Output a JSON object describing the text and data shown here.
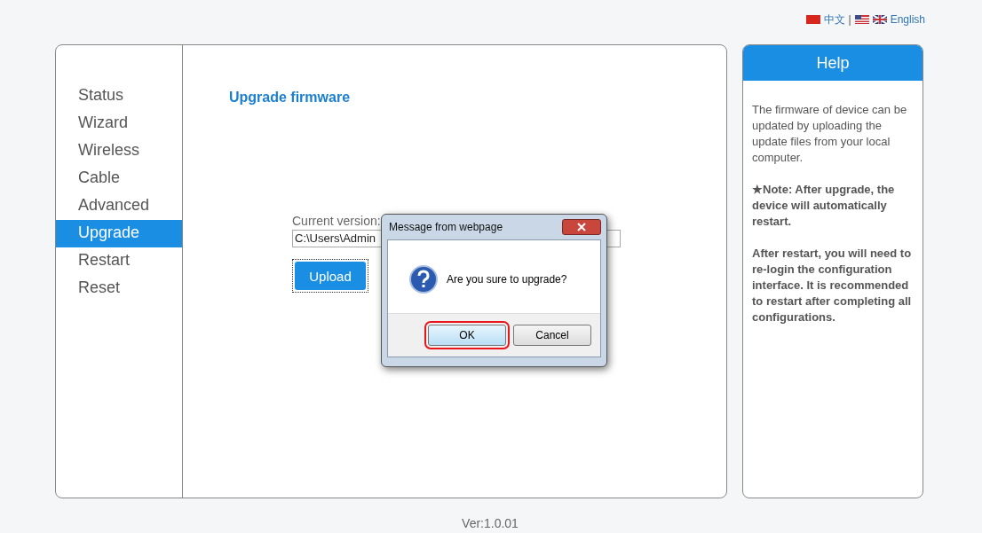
{
  "languages": [
    {
      "label": "中文"
    },
    {
      "label": "English"
    }
  ],
  "language_separator": "|",
  "sidebar": {
    "items": [
      {
        "label": "Status",
        "selected": false
      },
      {
        "label": "Wizard",
        "selected": false
      },
      {
        "label": "Wireless",
        "selected": false
      },
      {
        "label": "Cable",
        "selected": false
      },
      {
        "label": "Advanced",
        "selected": false
      },
      {
        "label": "Upgrade",
        "selected": true
      },
      {
        "label": "Restart",
        "selected": false
      },
      {
        "label": "Reset",
        "selected": false
      }
    ]
  },
  "main": {
    "title": "Upgrade firmware",
    "current_version_label": "Current version:",
    "file_path": "C:\\Users\\Admin",
    "upload_button": "Upload"
  },
  "dialog": {
    "title": "Message from webpage",
    "message": "Are you sure to upgrade?",
    "buttons": [
      {
        "label": "OK",
        "highlighted": true
      },
      {
        "label": "Cancel",
        "highlighted": false
      }
    ]
  },
  "help": {
    "title": "Help",
    "paragraphs": [
      {
        "text": "The firmware of device can be updated by uploading the update files from your local computer.",
        "bold": false
      },
      {
        "text": "★Note: After upgrade, the device will automatically restart.",
        "bold": true
      },
      {
        "text": "After restart, you will need to re-login the configuration interface. It is recommended to restart after completing all configurations.",
        "bold": true
      }
    ]
  },
  "footer": {
    "version": "Ver:1.0.01"
  }
}
